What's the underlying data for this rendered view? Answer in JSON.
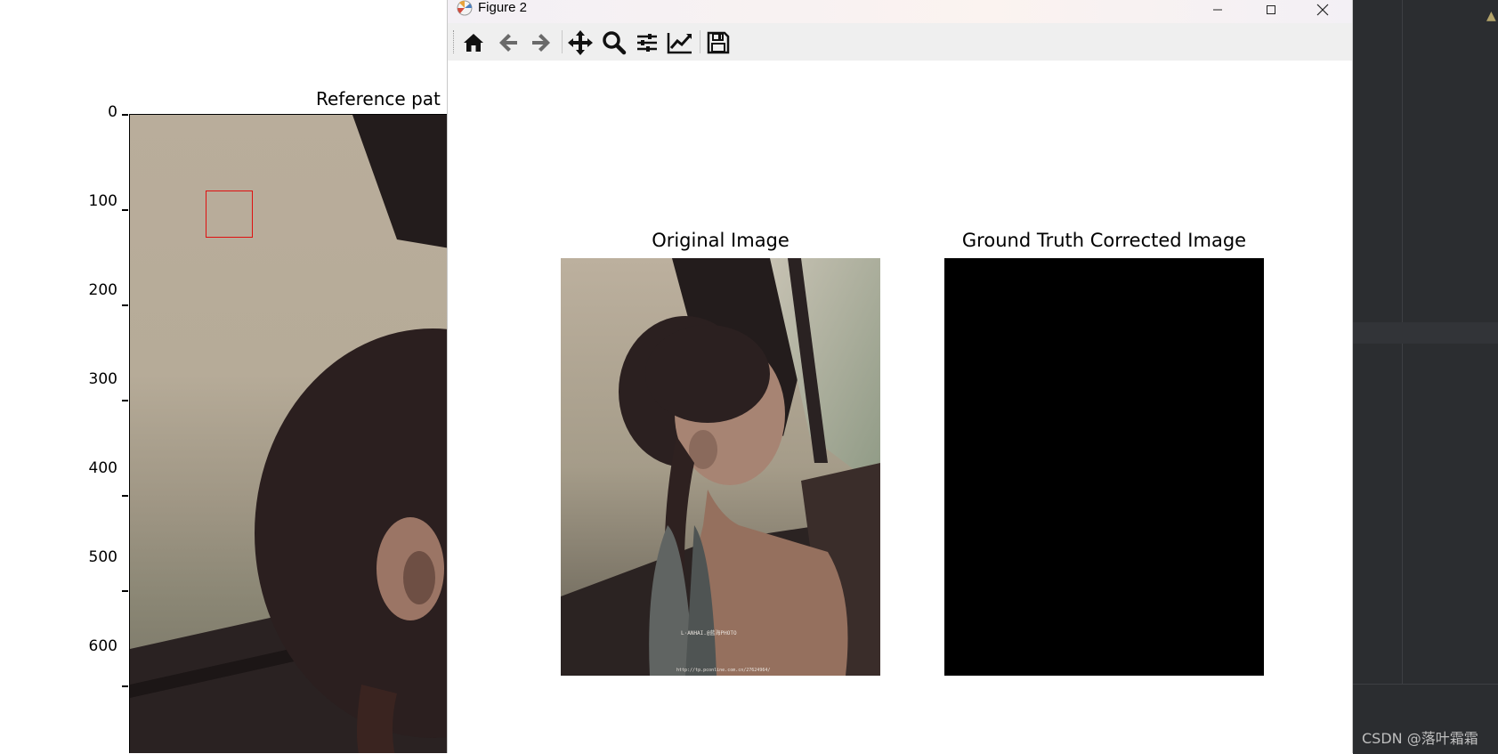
{
  "background_figure": {
    "title": "Reference pat",
    "y_ticks": [
      "0",
      "100",
      "200",
      "300",
      "400",
      "500",
      "600"
    ]
  },
  "figure_window": {
    "title": "Figure 2",
    "controls": {
      "minimize": "—",
      "maximize": "☐",
      "close": "✕"
    },
    "toolbar": [
      {
        "name": "home-icon"
      },
      {
        "name": "back-arrow-icon"
      },
      {
        "name": "forward-arrow-icon"
      },
      {
        "name": "pan-icon"
      },
      {
        "name": "zoom-icon"
      },
      {
        "name": "subplots-icon"
      },
      {
        "name": "edit-axis-icon"
      },
      {
        "name": "save-icon"
      }
    ],
    "panels": [
      {
        "title": "Original Image"
      },
      {
        "title": "Ground Truth Corrected Image"
      }
    ],
    "photo_watermark": {
      "brand": "L·ANHAI.@蓝海PHOTO",
      "url": "http://tp.pconline.com.cn/27624964/"
    }
  },
  "ide": {
    "watermark": "CSDN @落叶霜霜",
    "warning_icon": "warning-icon"
  },
  "colors": {
    "roi_box": "#e01010",
    "ide_bg": "#2b2d30",
    "toolbar_bg": "#efefef"
  }
}
